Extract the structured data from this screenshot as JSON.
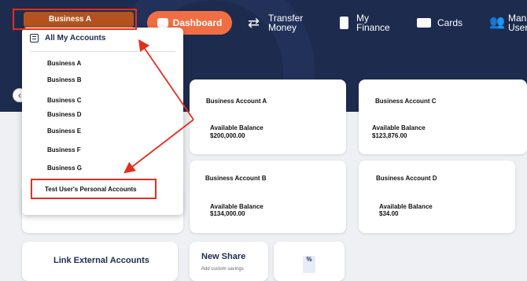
{
  "header": {
    "selected_business": "Business A",
    "nav": {
      "dashboard": "Dashboard",
      "transfer_line1": "Transfer",
      "transfer_line2": "Money",
      "finance_line1": "My",
      "finance_line2": "Finance",
      "cards": "Cards",
      "users_line1": "Mana",
      "users_line2": "User"
    }
  },
  "dropdown": {
    "header": "All My Accounts",
    "items": [
      "Business A",
      "Business B",
      "Business C",
      "Business D",
      "Business E",
      "Business F",
      "Business G"
    ],
    "personal": "Test User's Personal Accounts"
  },
  "accounts": [
    {
      "name": "Business Account A",
      "label": "Available Balance",
      "balance": "$200,000.00"
    },
    {
      "name": "Business Account C",
      "label": "Available Balance",
      "balance": "$123,876.00"
    },
    {
      "name": "Business Account B",
      "label": "Available Balance",
      "balance": "$134,000.00"
    },
    {
      "name": "Business Account D",
      "label": "Available Balance",
      "balance": "$34.00"
    }
  ],
  "bottom": {
    "link_external": "Link External Accounts",
    "new_share": "New Share",
    "new_share_sub": "Add custom savings",
    "percent_icon": "%"
  },
  "icons": {
    "nav_back": "chevron-left-icon",
    "dropdown_header": "list-icon",
    "dashboard": "dashboard-icon",
    "transfer": "transfer-icon",
    "finance": "finance-icon",
    "cards": "credit-card-icon",
    "users": "users-icon"
  },
  "colors": {
    "header_bg": "#1d2b4f",
    "accent": "#f06f42",
    "business_pill": "#b5531f",
    "annotation": "#e0301e"
  }
}
